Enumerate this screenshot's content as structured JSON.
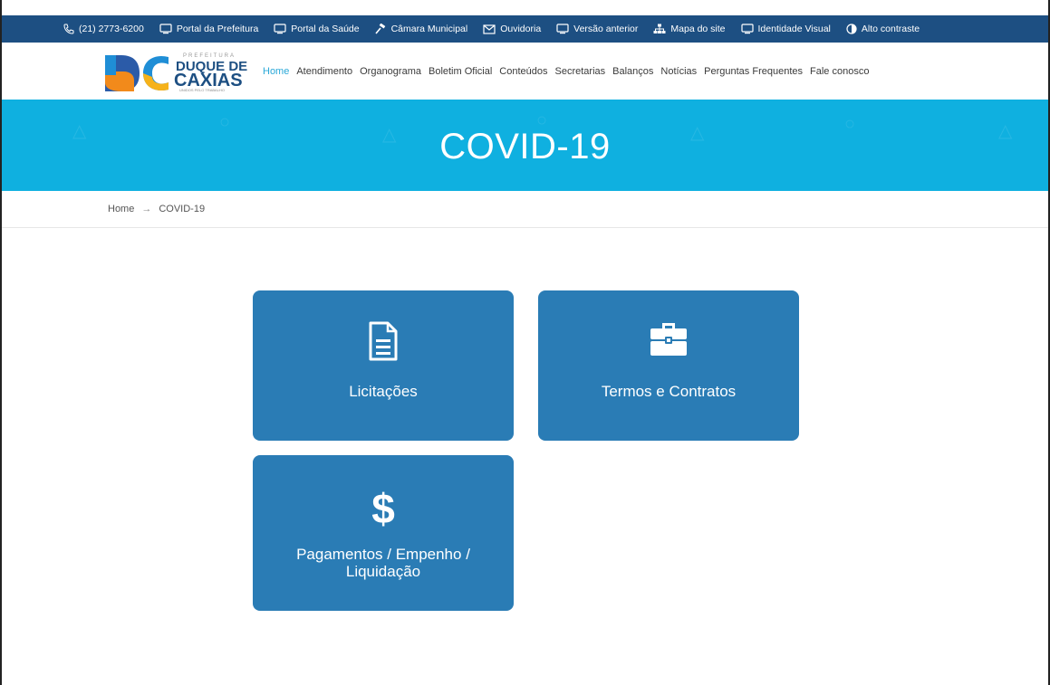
{
  "topbar": {
    "items": [
      {
        "label": "(21) 2773-6200",
        "icon": "phone-icon"
      },
      {
        "label": "Portal da Prefeitura",
        "icon": "monitor-icon"
      },
      {
        "label": "Portal da Saúde",
        "icon": "monitor-icon"
      },
      {
        "label": "Câmara Municipal",
        "icon": "gavel-icon"
      },
      {
        "label": "Ouvidoria",
        "icon": "mail-icon"
      },
      {
        "label": "Versão anterior",
        "icon": "monitor-icon"
      },
      {
        "label": "Mapa do site",
        "icon": "sitemap-icon"
      },
      {
        "label": "Identidade Visual",
        "icon": "monitor-icon"
      },
      {
        "label": "Alto contraste",
        "icon": "contrast-icon"
      }
    ]
  },
  "logo": {
    "line1": "PREFEITURA",
    "line2": "DUQUE DE",
    "line3": "CAXIAS",
    "tagline": "UNIDOS PELO TRABALHO"
  },
  "nav": {
    "items": [
      "Home",
      "Atendimento",
      "Organograma",
      "Boletim Oficial",
      "Conteúdos",
      "Secretarias",
      "Balanços",
      "Notícias",
      "Perguntas Frequentes",
      "Fale conosco"
    ]
  },
  "hero": {
    "title": "COVID-19"
  },
  "breadcrumb": {
    "home": "Home",
    "separator": "→",
    "current": "COVID-19"
  },
  "cards": {
    "licitacoes": "Licitações",
    "termos": "Termos e Contratos",
    "pagamentos_line1": "Pagamentos / Empenho /",
    "pagamentos_line2": "Liquidação"
  },
  "colors": {
    "topbar": "#1d4f82",
    "hero": "#0fb0e0",
    "card": "#2a7cb5",
    "nav_active": "#2aa8d8"
  }
}
